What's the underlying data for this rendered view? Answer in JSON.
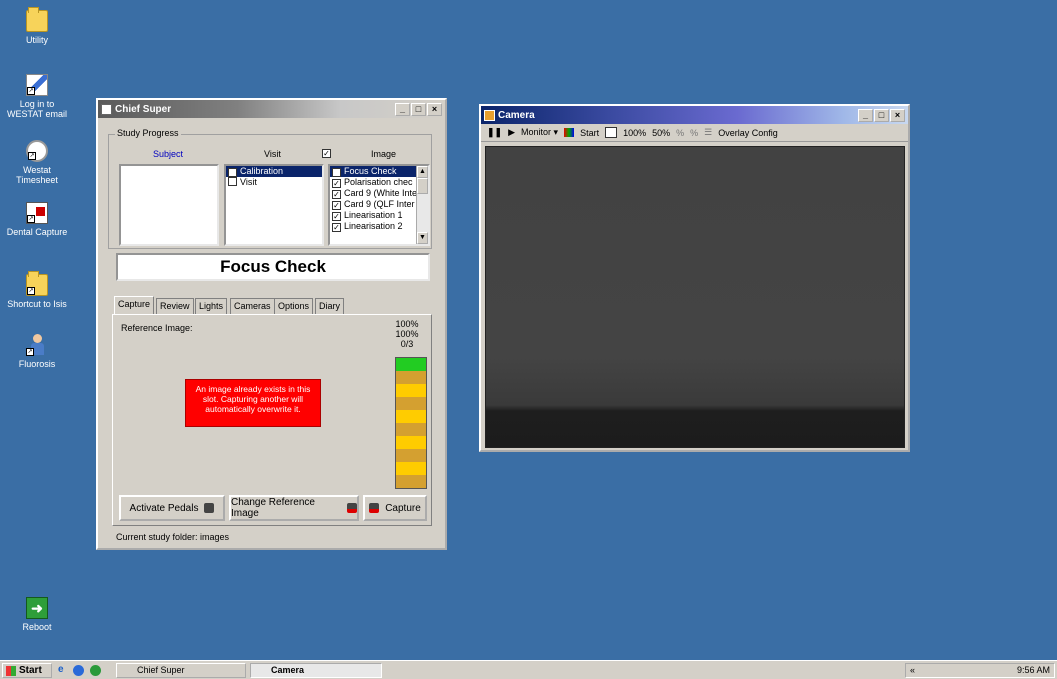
{
  "desktop": {
    "icons": [
      {
        "label": "Utility",
        "icon": "folder-icon"
      },
      {
        "label": "Log in to WESTAT email",
        "icon": "email-link-icon"
      },
      {
        "label": "Westat Timesheet",
        "icon": "clock-icon"
      },
      {
        "label": "Dental Capture",
        "icon": "dental-capture-icon"
      },
      {
        "label": "Shortcut to Isis",
        "icon": "folder-shortcut-icon"
      },
      {
        "label": "Fluorosis",
        "icon": "fluorosis-icon"
      },
      {
        "label": "Reboot",
        "icon": "reboot-icon"
      }
    ]
  },
  "chief": {
    "title": "Chief Super",
    "study_progress": "Study Progress",
    "subject_header": "Subject",
    "visit_header": "Visit",
    "image_header": "Image",
    "visit_items": [
      {
        "label": "Calibration",
        "checked": true,
        "selected": true
      },
      {
        "label": "Visit",
        "checked": false,
        "selected": false
      }
    ],
    "image_items": [
      {
        "label": "Focus Check",
        "checked": true,
        "selected": true
      },
      {
        "label": "Polarisation chec",
        "checked": true,
        "selected": false
      },
      {
        "label": "Card 9 (White Inte",
        "checked": true,
        "selected": false
      },
      {
        "label": "Card 9 (QLF Inter",
        "checked": true,
        "selected": false
      },
      {
        "label": "Linearisation 1",
        "checked": true,
        "selected": false
      },
      {
        "label": "Linearisation 2",
        "checked": true,
        "selected": false
      }
    ],
    "current_image": "Focus Check",
    "tabs": [
      "Capture",
      "Review",
      "Lights",
      "Cameras",
      "Options",
      "Diary"
    ],
    "reference_label": "Reference Image:",
    "stats": [
      "100%",
      "100%",
      "0/3"
    ],
    "warning": "An image already exists in this slot. Capturing another will automatically overwrite it.",
    "buttons": {
      "activate": "Activate Pedals",
      "change_ref": "Change Reference Image",
      "capture": "Capture"
    },
    "status": "Current study folder: images"
  },
  "camera": {
    "title": "Camera",
    "toolbar": {
      "monitor": "Monitor",
      "start": "Start",
      "zoom100": "100%",
      "zoom50": "50%",
      "overlay": "Overlay Config"
    }
  },
  "taskbar": {
    "start": "Start",
    "tasks": [
      "Chief Super",
      "Camera"
    ],
    "clock": "9:56 AM"
  },
  "colors": {
    "desktop": "#3a6ea5",
    "warning_red": "#ff0000",
    "meter_green": "#22cc22",
    "meter_dark": "#d4a030",
    "meter_yellow": "#ffcc00"
  }
}
